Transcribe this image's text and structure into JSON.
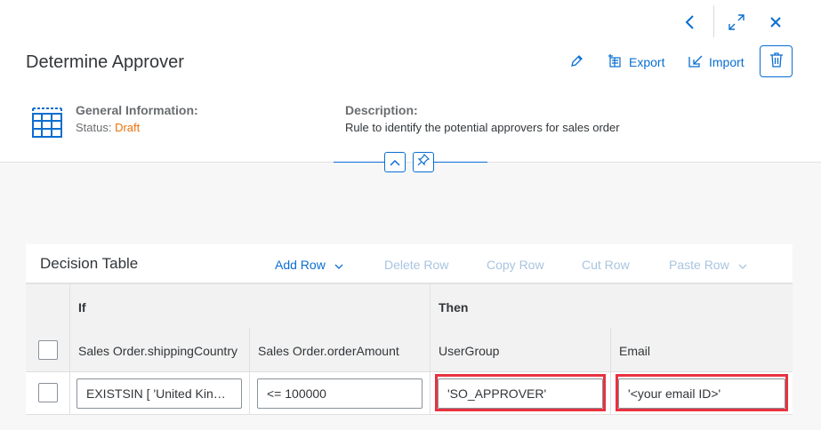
{
  "header": {
    "title": "Determine Approver",
    "actions": {
      "edit_icon": "pencil-icon",
      "export_label": "Export",
      "import_label": "Import",
      "delete_icon": "trash-icon"
    },
    "nav": {
      "back_icon": "chevron-left-icon",
      "fullscreen_icon": "exit-fullscreen-icon",
      "close_icon": "close-icon"
    },
    "general_info": {
      "label": "General Information:",
      "status_label": "Status:",
      "status_value": "Draft"
    },
    "description": {
      "label": "Description:",
      "text": "Rule to identify the potential approvers for sales order"
    }
  },
  "decision_table": {
    "title": "Decision Table",
    "toolbar": {
      "add_row": "Add Row",
      "delete_row": "Delete Row",
      "copy_row": "Copy Row",
      "cut_row": "Cut Row",
      "paste_row": "Paste Row"
    },
    "groups": {
      "if": "If",
      "then": "Then"
    },
    "columns": [
      "Sales Order.shippingCountry",
      "Sales Order.orderAmount",
      "UserGroup",
      "Email"
    ],
    "rows": [
      [
        "EXISTSIN [ 'United Kingdom' ]",
        "<= 100000",
        "'SO_APPROVER'",
        "'<your email ID>'"
      ]
    ]
  },
  "colors": {
    "accent": "#0a6ed1",
    "status_draft": "#e9730c",
    "highlight": "#e8323f"
  }
}
